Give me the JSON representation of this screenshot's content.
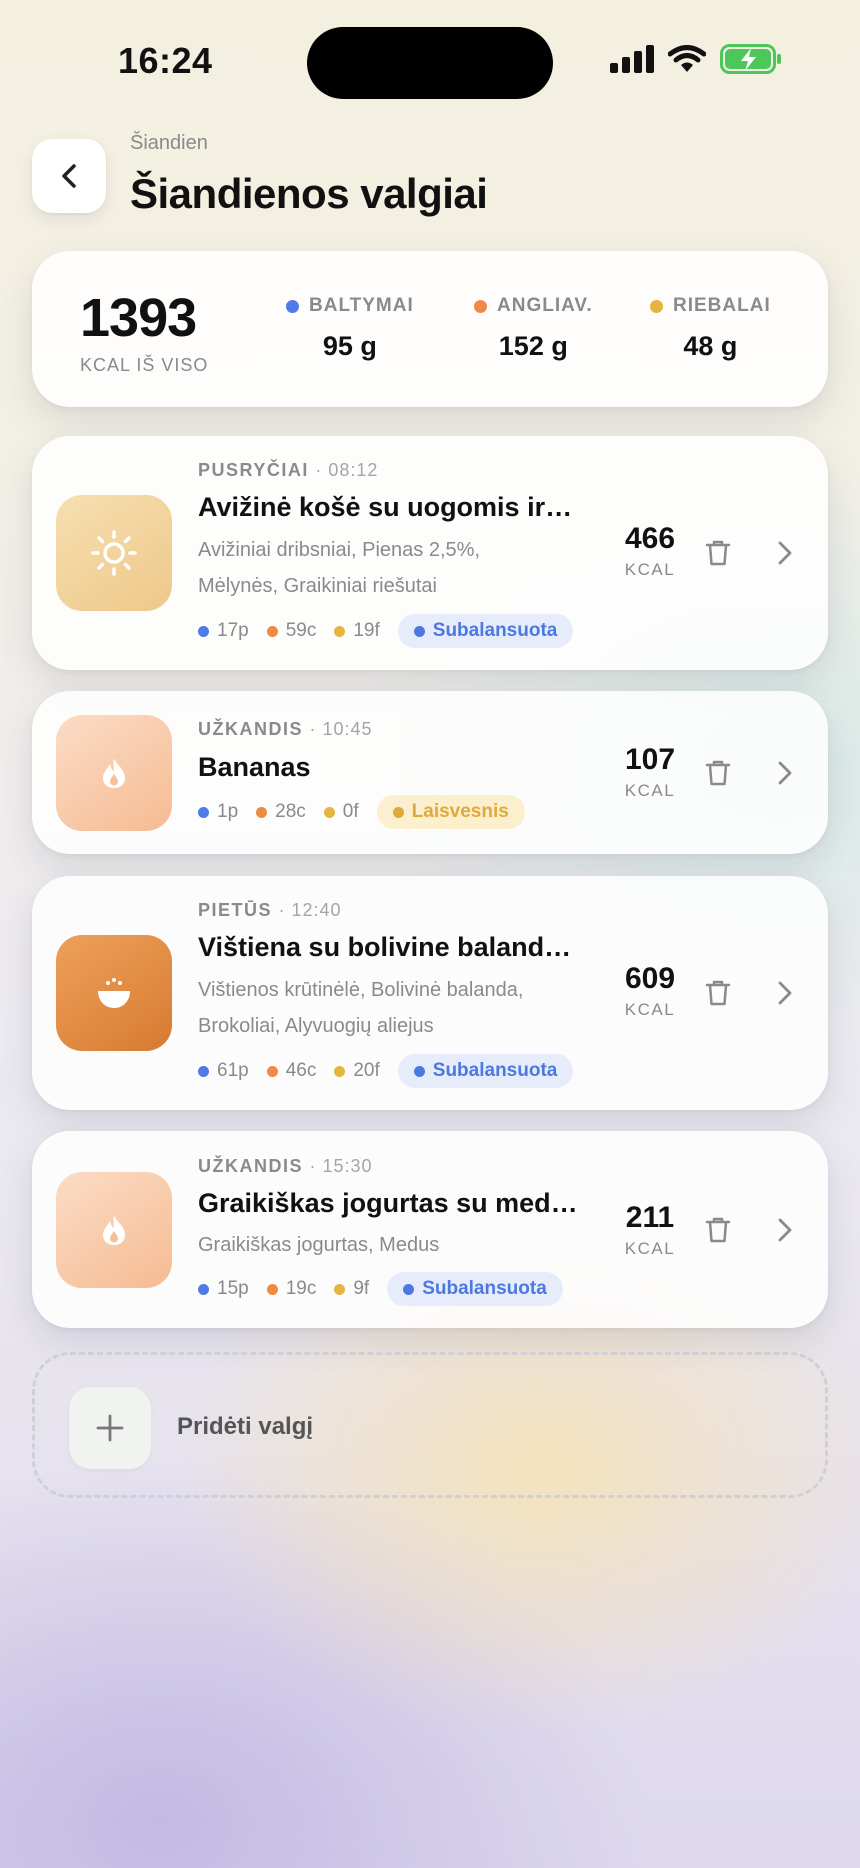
{
  "status": {
    "time": "16:24"
  },
  "header": {
    "subtitle": "Šiandien",
    "title": "Šiandienos valgiai"
  },
  "summary": {
    "total_value": "1393",
    "total_label": "KCAL IŠ VISO",
    "macros": [
      {
        "label": "BALTYMAI",
        "value": "95 g",
        "color": "#4f7be8"
      },
      {
        "label": "ANGLIAV.",
        "value": "152 g",
        "color": "#ef8a45"
      },
      {
        "label": "RIEBALAI",
        "value": "48 g",
        "color": "#e6b43f"
      }
    ]
  },
  "colors": {
    "protein": "#4f7be8",
    "carbs": "#ef8a45",
    "fat": "#e6b43f"
  },
  "meals": [
    {
      "type": "PUSRYČIAI",
      "time": "· 08:12",
      "name": "Avižinė košė su uogomis ir…",
      "ingredients": "Avižiniai dribsniai, Pienas 2,5%, Mėlynės, Graikiniai riešutai",
      "protein": "17p",
      "carbs": "59c",
      "fat": "19f",
      "badge": "Subalansuota",
      "kcal": "466",
      "kcal_label": "KCAL",
      "icon": "sun-icon"
    },
    {
      "type": "UŽKANDIS",
      "time": "· 10:45",
      "name": "Bananas",
      "ingredients": "",
      "protein": "1p",
      "carbs": "28c",
      "fat": "0f",
      "badge": "Laisvesnis",
      "kcal": "107",
      "kcal_label": "KCAL",
      "icon": "flame-icon"
    },
    {
      "type": "PIETŪS",
      "time": "· 12:40",
      "name": "Vištiena su bolivine baland…",
      "ingredients": "Vištienos krūtinėlė, Bolivinė balanda, Brokoliai, Alyvuogių aliejus",
      "protein": "61p",
      "carbs": "46c",
      "fat": "20f",
      "badge": "Subalansuota",
      "kcal": "609",
      "kcal_label": "KCAL",
      "icon": "bowl-icon"
    },
    {
      "type": "UŽKANDIS",
      "time": "· 15:30",
      "name": "Graikiškas jogurtas su med…",
      "ingredients": "Graikiškas jogurtas, Medus",
      "protein": "15p",
      "carbs": "19c",
      "fat": "9f",
      "badge": "Subalansuota",
      "kcal": "211",
      "kcal_label": "KCAL",
      "icon": "flame-icon"
    }
  ],
  "add_meal": {
    "label": "Pridėti valgį"
  }
}
